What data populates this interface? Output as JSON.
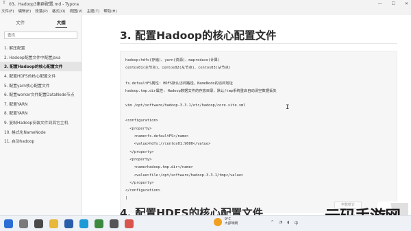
{
  "window": {
    "title": "03、Hadoop3集群配置.md - Typora",
    "controls": [
      "—",
      "☐",
      "✕"
    ]
  },
  "menu": [
    "文件(F)",
    "编辑(E)",
    "段落(P)",
    "格式(O)",
    "视图(V)",
    "主题(T)",
    "帮助(H)"
  ],
  "sidebar": {
    "tabs": [
      "文件",
      "大纲"
    ],
    "active_tab": "大纲",
    "search_placeholder": "查找",
    "outline": [
      "1. 解压配置",
      "2. Hadoop配置文件中配置Java",
      "3. 配置Hadoop的核心配置文件",
      "4. 配置HDFS的核心配置文件",
      "5. 配置yarn核心配置文件",
      "6. 配置worker文件配置DataNode节点",
      "7. 配置YARN",
      "8. 配置YARN",
      "9. 复制Hadoop安装文件到其它主机",
      "10. 格式化NameNode",
      "11. 启动hadoop"
    ],
    "active_index": 2
  },
  "main": {
    "heading": "3. 配置Hadoop的核心配置文件",
    "next_heading": "4. 配置HDFS的核心配置文件",
    "word_count": "字数统计",
    "code_lines": [
      "hadoop:hdfs(存储)、yarn(资源)、mapreduce(计算)",
      "centos01(主节点)、centos02(从节点)、centos03(从节点)",
      "",
      "fs.defaultFS属性: HDFS默认访问路径，NameNode的访问地址",
      "hadoop.tmp.dir属性: Hadoop数据文件的存放目录，默认/tmp系统重启自动清空数据丢失",
      "",
      "vim /opt/software/hadoop-3.3.1/etc/hadoop/core-site.xml",
      "",
      "<configuration>",
      "  <property>",
      "    <name>fs.defaultFS</name>",
      "    <value>hdfs://centos01:9000</value>",
      "  </property>",
      "  <property>",
      "    <name>hadoop.tmp.dir</name>",
      "    <value>file:/opt/software/hadoop-3.3.1/tmp</value>",
      "  </property>",
      "</configuration>",
      "|"
    ]
  },
  "taskbar": {
    "icons": [
      {
        "name": "windows-start-icon",
        "color": "#2b6fd6"
      },
      {
        "name": "search-icon",
        "color": "#7a7a7a"
      },
      {
        "name": "task-view-icon",
        "color": "#4a4a4a"
      },
      {
        "name": "file-explorer-icon",
        "color": "#e8b83a"
      },
      {
        "name": "word-icon",
        "color": "#2a5caa"
      },
      {
        "name": "edge-icon",
        "color": "#1a9ad6"
      },
      {
        "name": "chrome-icon",
        "color": "#3b8a3e"
      },
      {
        "name": "typora-icon",
        "color": "#555555"
      },
      {
        "name": "app-icon",
        "color": "#d9534f"
      }
    ],
    "weather": {
      "temp": "9°C",
      "desc": "大部晴朗"
    }
  },
  "watermark": {
    "text": "元码手游网"
  }
}
